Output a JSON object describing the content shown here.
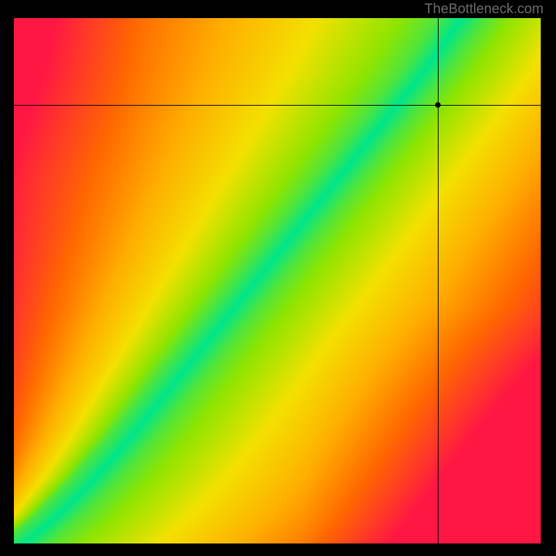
{
  "watermark": "TheBottleneck.com",
  "chart_data": {
    "type": "heatmap",
    "title": "",
    "xlabel": "",
    "ylabel": "",
    "xlim": [
      0,
      1
    ],
    "ylim": [
      0,
      1
    ],
    "marker": {
      "x": 0.805,
      "y": 0.835
    },
    "crosshair": {
      "x": 0.805,
      "y": 0.835
    },
    "ridge": {
      "description": "Green optimal band running roughly diagonally from bottom-left corner; band curves slightly, starting near x≈0.02 at y=0 and reaching x≈0.82 at y=1. Colors transition from green at ridge center through yellow to orange and red away from it; upper-left and bottom-right corners are deepest red.",
      "center_points": [
        {
          "x": 0.02,
          "y": 0.0
        },
        {
          "x": 0.08,
          "y": 0.05
        },
        {
          "x": 0.15,
          "y": 0.12
        },
        {
          "x": 0.22,
          "y": 0.2
        },
        {
          "x": 0.3,
          "y": 0.3
        },
        {
          "x": 0.38,
          "y": 0.4
        },
        {
          "x": 0.46,
          "y": 0.5
        },
        {
          "x": 0.54,
          "y": 0.6
        },
        {
          "x": 0.62,
          "y": 0.7
        },
        {
          "x": 0.7,
          "y": 0.8
        },
        {
          "x": 0.78,
          "y": 0.9
        },
        {
          "x": 0.85,
          "y": 1.0
        }
      ],
      "band_halfwidth_fraction": 0.045
    },
    "color_stops": [
      {
        "t": 0.0,
        "color": "#00e58a"
      },
      {
        "t": 0.18,
        "color": "#8fe500"
      },
      {
        "t": 0.36,
        "color": "#f4e100"
      },
      {
        "t": 0.55,
        "color": "#ffb000"
      },
      {
        "t": 0.75,
        "color": "#ff6a00"
      },
      {
        "t": 1.0,
        "color": "#ff1744"
      }
    ]
  }
}
